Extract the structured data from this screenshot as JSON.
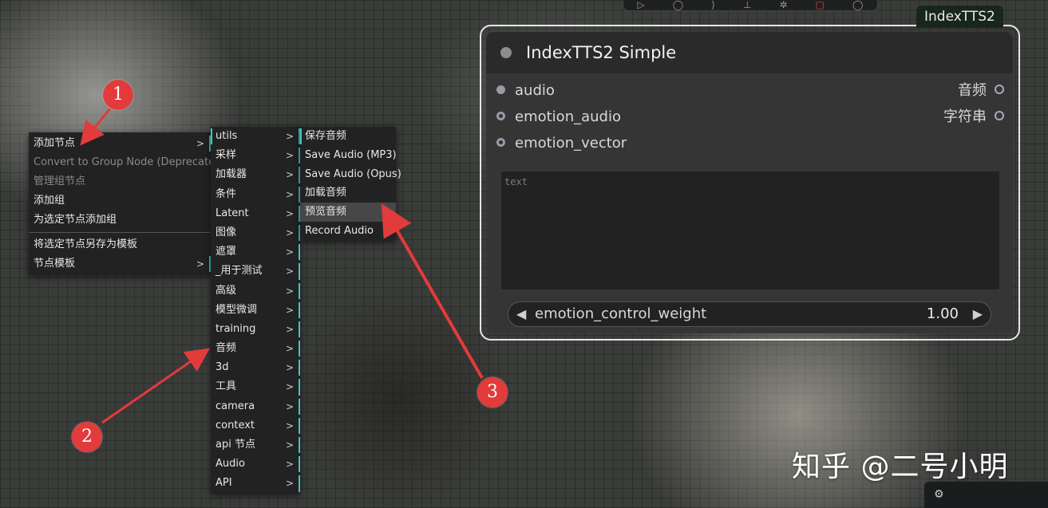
{
  "context_menu": {
    "items": [
      {
        "label": "添加节点",
        "arrow": ">"
      },
      {
        "label": "Convert to Group Node (Deprecated)"
      },
      {
        "label": "管理组节点"
      },
      {
        "label": "添加组"
      },
      {
        "label": "为选定节点添加组"
      },
      {
        "label": "将选定节点另存为模板"
      },
      {
        "label": "节点模板",
        "arrow": ">"
      }
    ]
  },
  "category_menu": {
    "items": [
      {
        "label": "utils",
        "arrow": ">"
      },
      {
        "label": "采样",
        "arrow": ">"
      },
      {
        "label": "加载器",
        "arrow": ">"
      },
      {
        "label": "条件",
        "arrow": ">"
      },
      {
        "label": "Latent",
        "arrow": ">"
      },
      {
        "label": "图像",
        "arrow": ">"
      },
      {
        "label": "遮罩",
        "arrow": ">"
      },
      {
        "label": "_用于测试",
        "arrow": ">"
      },
      {
        "label": "高级",
        "arrow": ">"
      },
      {
        "label": "模型微调",
        "arrow": ">"
      },
      {
        "label": "training",
        "arrow": ">"
      },
      {
        "label": "音频",
        "arrow": ">"
      },
      {
        "label": "3d",
        "arrow": ">"
      },
      {
        "label": "工具",
        "arrow": ">"
      },
      {
        "label": "camera",
        "arrow": ">"
      },
      {
        "label": "context",
        "arrow": ">"
      },
      {
        "label": "api 节点",
        "arrow": ">"
      },
      {
        "label": "Audio",
        "arrow": ">"
      },
      {
        "label": "API",
        "arrow": ">"
      }
    ]
  },
  "audio_menu": {
    "items": [
      {
        "label": "保存音频"
      },
      {
        "label": "Save Audio (MP3)"
      },
      {
        "label": "Save Audio (Opus)"
      },
      {
        "label": "加载音频"
      },
      {
        "label": "预览音频"
      },
      {
        "label": "Record Audio"
      }
    ]
  },
  "node": {
    "group_tag": "IndexTTS2",
    "title": "IndexTTS2 Simple",
    "inputs": [
      "audio",
      "emotion_audio",
      "emotion_vector"
    ],
    "outputs": [
      "音频",
      "字符串"
    ],
    "text_placeholder": "text",
    "widget": {
      "name": "emotion_control_weight",
      "value": "1.00",
      "left_arrow": "◀",
      "right_arrow": "▶"
    }
  },
  "annotations": [
    "1",
    "2",
    "3"
  ],
  "watermark": "知乎 @二号小明",
  "colors": {
    "annotation": "#e23b3b",
    "menu_accent": "#3cc6c6",
    "menu_bg": "#222222",
    "node_bg": "#353535"
  }
}
